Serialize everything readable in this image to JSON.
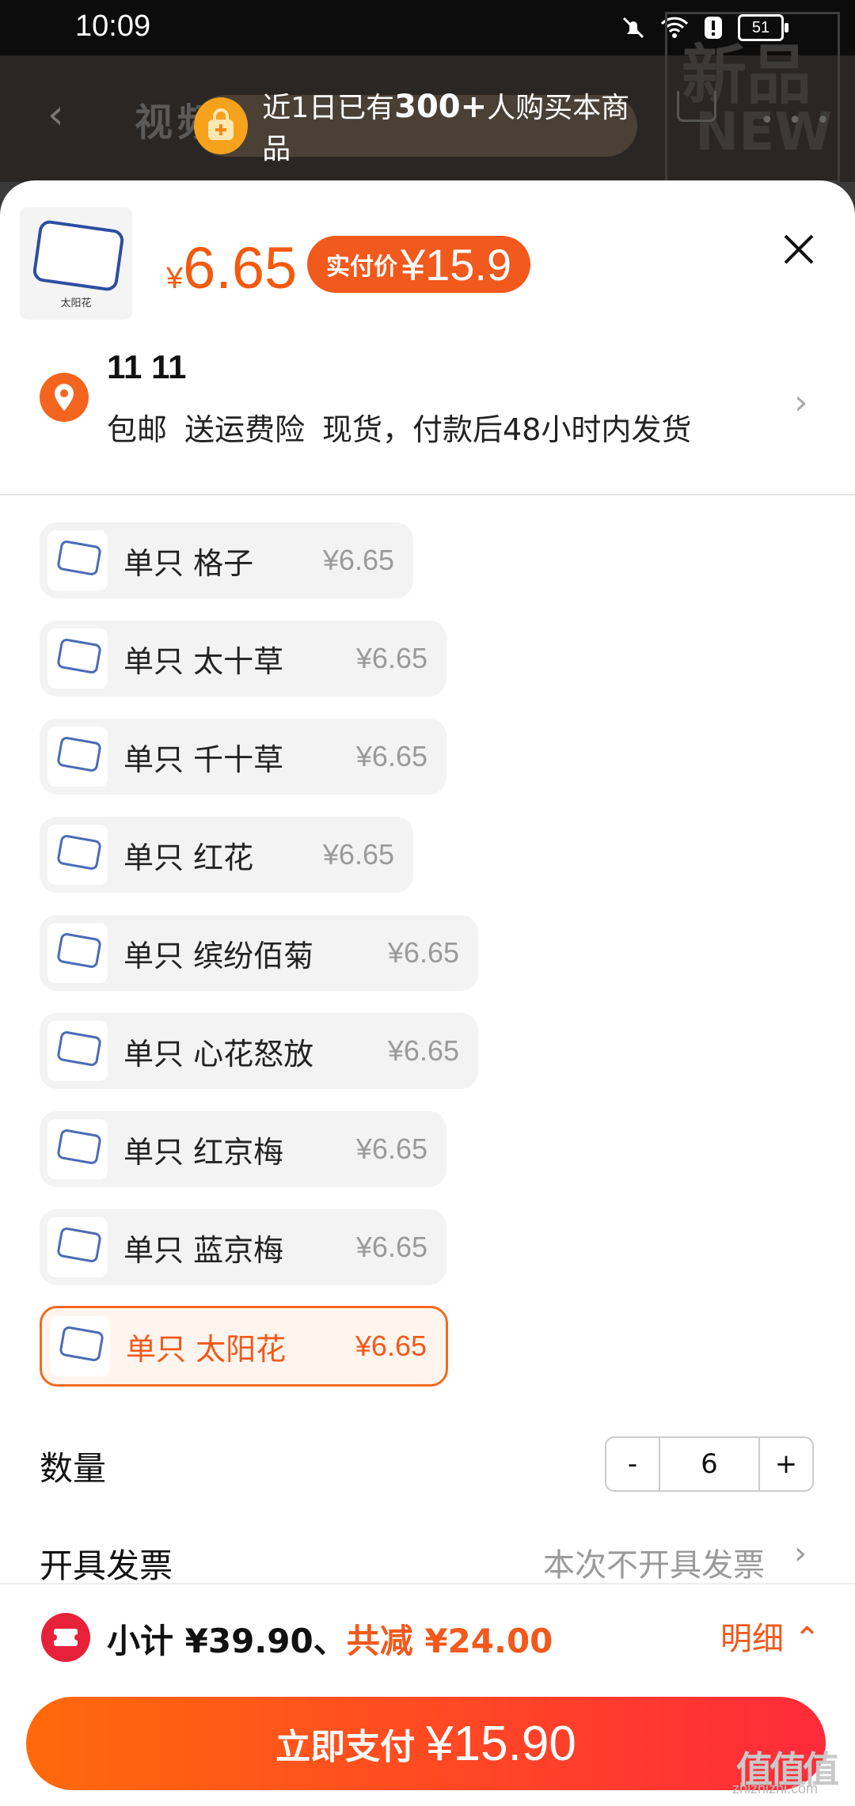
{
  "status": {
    "time": "10:09",
    "battery": "51"
  },
  "bg": {
    "tabs": "视频 图集",
    "new_badge_1": "新品",
    "new_badge_2": "NEW"
  },
  "promo": {
    "prefix": "近1日已有",
    "count": "300+",
    "suffix": "人购买本商品"
  },
  "product": {
    "thumb_label": "太阳花",
    "price_symbol": "¥",
    "price": "6.65",
    "actual_label": "实付价",
    "actual_price": "¥15.9"
  },
  "address": {
    "name": "11 11",
    "tags": [
      "包邮",
      "送运费险",
      "现货，付款后48小时内发货"
    ]
  },
  "options": [
    {
      "name": "单只 格子",
      "price": "¥6.65"
    },
    {
      "name": "单只 太十草",
      "price": "¥6.65"
    },
    {
      "name": "单只 千十草",
      "price": "¥6.65"
    },
    {
      "name": "单只 红花",
      "price": "¥6.65"
    },
    {
      "name": "单只 缤纷佰菊",
      "price": "¥6.65"
    },
    {
      "name": "单只 心花怒放",
      "price": "¥6.65"
    },
    {
      "name": "单只 红京梅",
      "price": "¥6.65"
    },
    {
      "name": "单只 蓝京梅",
      "price": "¥6.65"
    },
    {
      "name": "单只 太阳花",
      "price": "¥6.65"
    }
  ],
  "quantity": {
    "label": "数量",
    "minus": "-",
    "value": "6",
    "plus": "+"
  },
  "invoice": {
    "label": "开具发票",
    "value": "本次不开具发票"
  },
  "footer": {
    "subtotal": "小计 ¥39.90、",
    "discount": "共减 ¥24.00",
    "detail": "明细",
    "pay_label": "立即支付",
    "pay_amount": "¥15.90"
  },
  "watermark": {
    "text": "值值值",
    "site": "zhizhizhi.com"
  }
}
